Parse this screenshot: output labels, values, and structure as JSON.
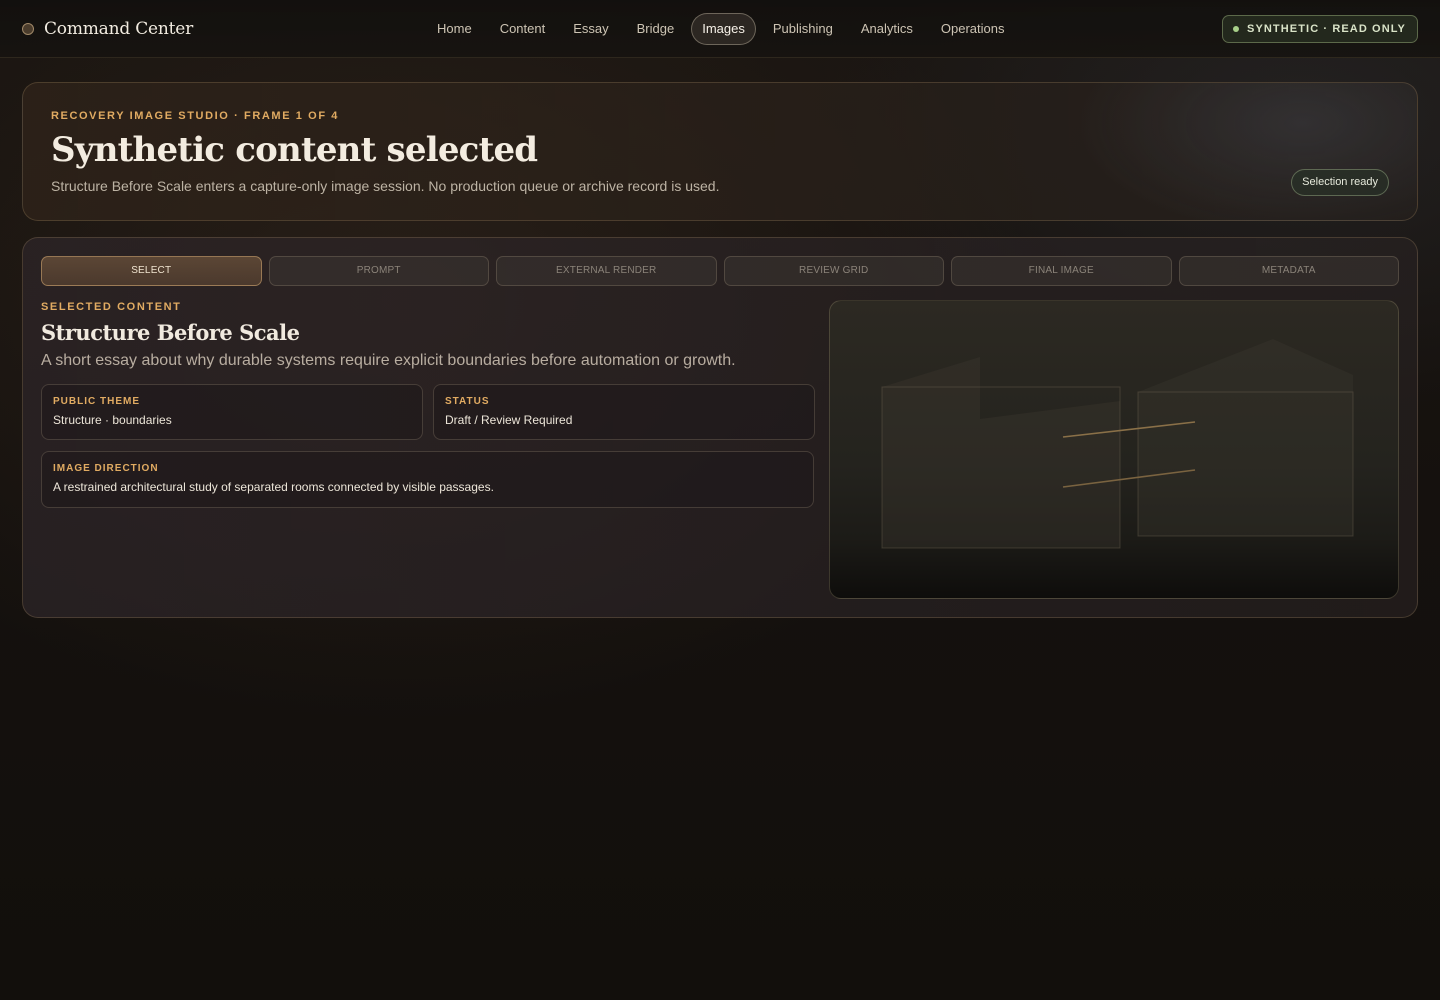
{
  "header": {
    "brand": "Command Center",
    "nav": [
      {
        "label": "Home"
      },
      {
        "label": "Content"
      },
      {
        "label": "Essay"
      },
      {
        "label": "Bridge"
      },
      {
        "label": "Images",
        "active": true
      },
      {
        "label": "Publishing"
      },
      {
        "label": "Analytics"
      },
      {
        "label": "Operations"
      }
    ],
    "status_pill": "SYNTHETIC · READ ONLY"
  },
  "hero": {
    "eyebrow": "RECOVERY IMAGE STUDIO · FRAME 1 OF 4",
    "title": "Synthetic content selected",
    "subtitle": "Structure Before Scale enters a capture-only image session. No production queue or archive record is used.",
    "badge": "Selection ready"
  },
  "steps": [
    {
      "label": "SELECT",
      "active": true
    },
    {
      "label": "PROMPT"
    },
    {
      "label": "EXTERNAL RENDER"
    },
    {
      "label": "REVIEW GRID"
    },
    {
      "label": "FINAL IMAGE"
    },
    {
      "label": "METADATA"
    }
  ],
  "selection": {
    "eyebrow": "SELECTED CONTENT",
    "title": "Structure Before Scale",
    "description": "A short essay about why durable systems require explicit boundaries before automation or growth.",
    "public_theme_label": "PUBLIC THEME",
    "public_theme_value": "Structure · boundaries",
    "status_label": "STATUS",
    "status_value": "Draft / Review Required",
    "image_direction_label": "IMAGE DIRECTION",
    "image_direction_value": "A restrained architectural study of separated rooms connected by visible passages."
  },
  "colors": {
    "accent": "#e1ab62",
    "status_green": "#a8d08a",
    "background": "#15110e"
  }
}
